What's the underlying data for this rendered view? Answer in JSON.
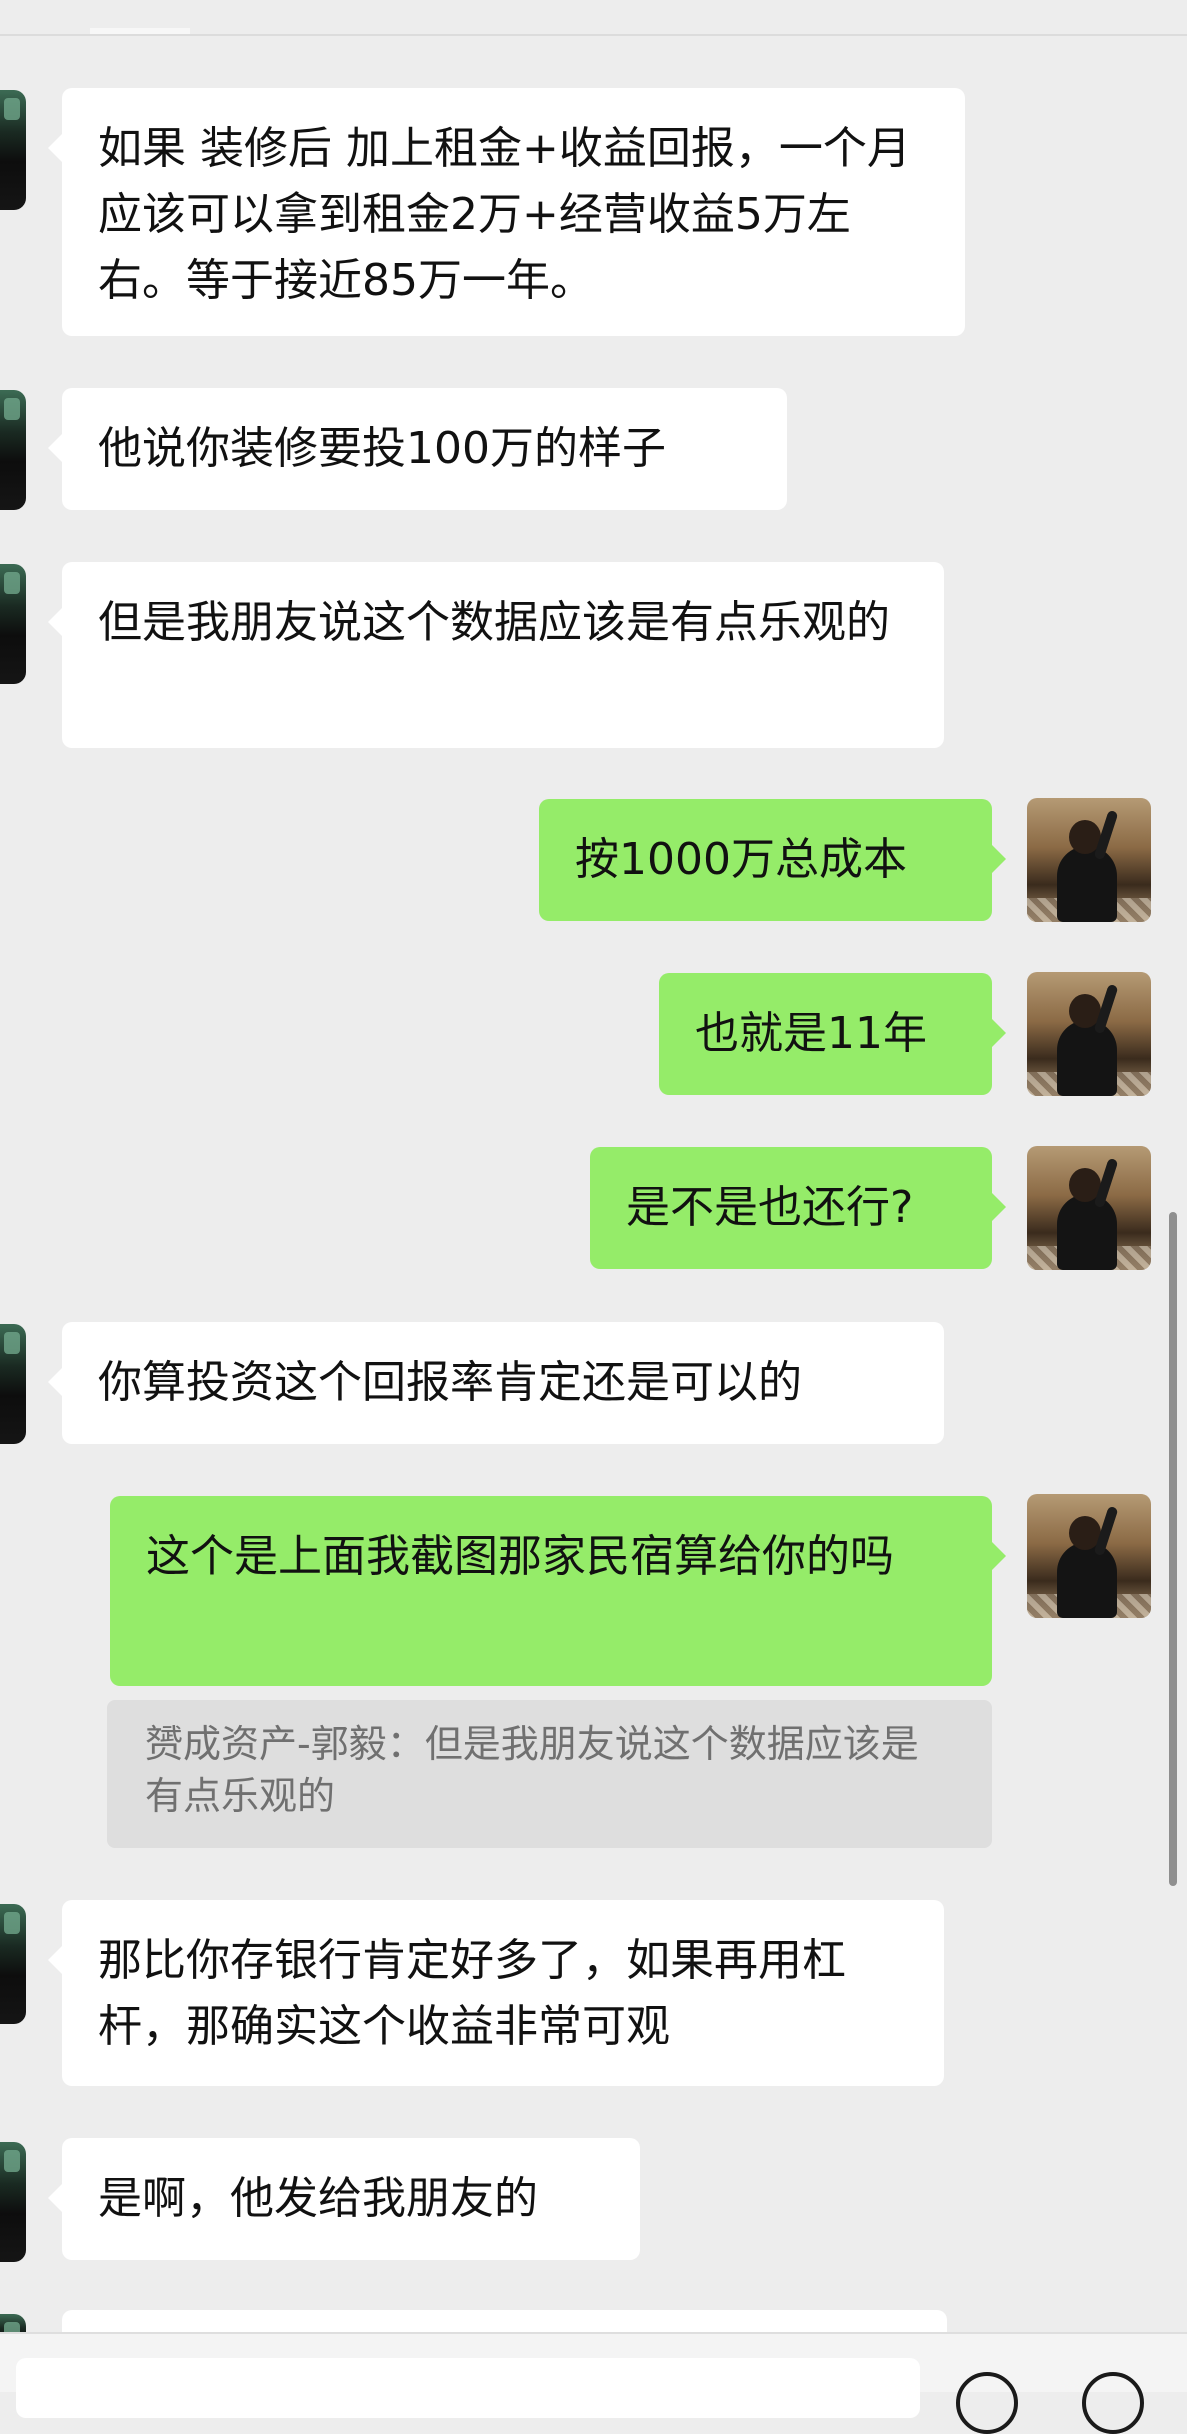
{
  "messages": [
    {
      "side": "left",
      "text": "如果 装修后 加上租金+收益回报，一个月应该可以拿到租金2万+经营收益5万左右。等于接近85万一年。"
    },
    {
      "side": "left",
      "text": "他说你装修要投100万的样子"
    },
    {
      "side": "left",
      "text": "但是我朋友说这个数据应该是有点乐观的"
    },
    {
      "side": "right",
      "text": "按1000万总成本"
    },
    {
      "side": "right",
      "text": "也就是11年"
    },
    {
      "side": "right",
      "text": "是不是也还行?"
    },
    {
      "side": "left",
      "text": "你算投资这个回报率肯定还是可以的"
    },
    {
      "side": "right",
      "text": "这个是上面我截图那家民宿算给你的吗"
    },
    {
      "side": "left",
      "text": "那比你存银行肯定好多了，如果再用杠杆，那确实这个收益非常可观"
    },
    {
      "side": "left",
      "text": "是啊，他发给我朋友的"
    }
  ],
  "quote": {
    "text": "赟成资产-郭毅：但是我朋友说这个数据应该是有点乐观的"
  },
  "colors": {
    "background": "#ededed",
    "left_bubble": "#ffffff",
    "right_bubble": "#95ec69"
  },
  "icons": {
    "left_avatar": "contact-avatar",
    "right_avatar": "self-avatar"
  }
}
